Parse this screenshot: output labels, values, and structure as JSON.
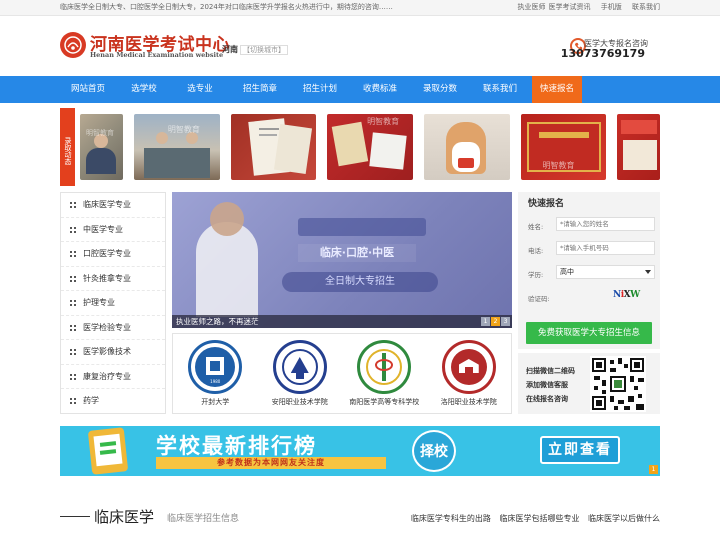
{
  "topbar": {
    "notice": "临床医学全日制大专、口腔医学全日制大专，2024年对口临床医学升学报名火热进行中，期待您的咨询……",
    "links": [
      "执业医师",
      "医学考试资讯",
      "手机版",
      "联系我们"
    ]
  },
  "header": {
    "logo_title": "河南医学考试中心",
    "logo_subtitle": "Henan Medical Examination website",
    "region": "河南",
    "region_switch": "【切换城市】",
    "phone_label": "医学大专报名咨询",
    "phone_number": "13073769179"
  },
  "nav": {
    "items": [
      "网站首页",
      "选学校",
      "选专业",
      "招生简章",
      "招生计划",
      "收费标准",
      "录取分数",
      "联系我们",
      "快速报名"
    ]
  },
  "enroll": {
    "tag": "录取动态",
    "photos": [
      {
        "watermark": "明智教育"
      },
      {
        "watermark": "明智教育"
      },
      {
        "watermark": ""
      },
      {
        "watermark": "明智教育"
      },
      {
        "watermark": ""
      },
      {
        "watermark": "明智教育"
      },
      {
        "watermark": ""
      }
    ]
  },
  "sidebar": {
    "items": [
      "临床医学专业",
      "中医学专业",
      "口腔医学专业",
      "针灸推拿专业",
      "护理专业",
      "医学检验专业",
      "医学影像技术",
      "康复治疗专业",
      "药学"
    ]
  },
  "slider": {
    "caption": "执业医师之路，不再迷茫",
    "overlay_line1": "临床·口腔·中医",
    "overlay_line2": "全日制大专招生",
    "pages": [
      "1",
      "2",
      "3"
    ],
    "active_page": 2
  },
  "schools": [
    {
      "name": "开封大学",
      "seal_text": "KAIFENG UNIVERSITY",
      "year": "1980"
    },
    {
      "name": "安阳职业技术学院",
      "seal_text": "",
      "year": ""
    },
    {
      "name": "南阳医学高等专科学校",
      "seal_text": "",
      "year": ""
    },
    {
      "name": "洛阳职业技术学院",
      "seal_text": "",
      "year": ""
    }
  ],
  "apply": {
    "title": "快速报名",
    "name_label": "姓名:",
    "name_placeholder": "*请输入您的姓名",
    "phone_label": "电话:",
    "phone_placeholder": "*请输入手机号码",
    "edu_label": "学历:",
    "edu_value": "高中",
    "captcha_label": "验证码:",
    "captcha": "NiXW",
    "submit": "免费获取医学大专招生信息"
  },
  "qr": {
    "lines": [
      "扫描微信二维码",
      "添加微信客服",
      "在线报名咨询"
    ]
  },
  "rank": {
    "title": "学校最新排行榜",
    "tagline": "参考数据为本网网友关注度",
    "badge_text": "择校",
    "cta": "立即查看",
    "page": "1"
  },
  "section": {
    "heading": "临床医学",
    "subheading": "临床医学招生信息",
    "links": [
      "临床医学专科生的出路",
      "临床医学包括哪些专业",
      "临床医学以后做什么"
    ]
  },
  "colors": {
    "nav_blue": "#2688e7",
    "accent_orange": "#f06a1a",
    "brand_red": "#c9331e",
    "apply_green": "#36b94a",
    "banner_cyan": "#38c2e6"
  }
}
